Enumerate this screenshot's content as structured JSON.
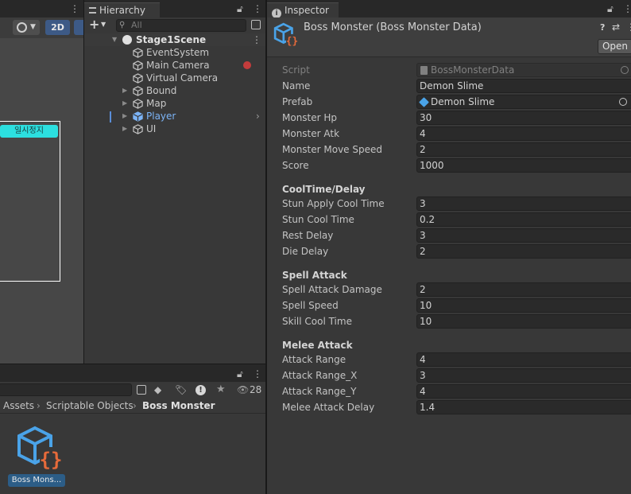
{
  "scene_view": {
    "toolbar_2d": "2D",
    "pause_button_label": "일시정지"
  },
  "hierarchy": {
    "tab_label": "Hierarchy",
    "search_placeholder": "All",
    "scene_name": "Stage1Scene",
    "items": [
      {
        "label": "EventSystem",
        "has_children": false
      },
      {
        "label": "Main Camera",
        "has_children": false
      },
      {
        "label": "Virtual Camera",
        "has_children": false
      },
      {
        "label": "Bound",
        "has_children": true
      },
      {
        "label": "Map",
        "has_children": true
      },
      {
        "label": "Player",
        "has_children": true,
        "highlighted": true
      },
      {
        "label": "UI",
        "has_children": true
      }
    ]
  },
  "project": {
    "breadcrumb": [
      "Assets",
      "Scriptable Objects",
      "Boss Monster"
    ],
    "hidden_count": "28",
    "asset_label": "Boss Mons..."
  },
  "inspector": {
    "tab_label": "Inspector",
    "title": "Boss Monster (Boss Monster Data)",
    "open_button": "Open",
    "script_label": "Script",
    "script_value": "BossMonsterData",
    "fields_top": [
      {
        "label": "Name",
        "value": "Demon Slime"
      },
      {
        "label": "Prefab",
        "value": "Demon Slime"
      },
      {
        "label": "Monster Hp",
        "value": "30"
      },
      {
        "label": "Monster Atk",
        "value": "4"
      },
      {
        "label": "Monster Move Speed",
        "value": "2"
      },
      {
        "label": "Score",
        "value": "1000"
      }
    ],
    "sections": [
      {
        "title": "CoolTime/Delay",
        "fields": [
          {
            "label": "Stun Apply Cool Time",
            "value": "3"
          },
          {
            "label": "Stun Cool Time",
            "value": "0.2"
          },
          {
            "label": "Rest Delay",
            "value": "3"
          },
          {
            "label": "Die Delay",
            "value": "2"
          }
        ]
      },
      {
        "title": "Spell Attack",
        "fields": [
          {
            "label": "Spell Attack Damage",
            "value": "2"
          },
          {
            "label": "Spell Speed",
            "value": "10"
          },
          {
            "label": "Skill Cool Time",
            "value": "10"
          }
        ]
      },
      {
        "title": "Melee Attack",
        "fields": [
          {
            "label": "Attack Range",
            "value": "4"
          },
          {
            "label": "Attack Range_X",
            "value": "3"
          },
          {
            "label": "Attack Range_Y",
            "value": "4"
          },
          {
            "label": "Melee Attack Delay",
            "value": "1.4"
          }
        ]
      }
    ]
  },
  "colors": {
    "accent_blue": "#7cb4f7",
    "asset_icon_blue": "#4aa3e8",
    "asset_icon_orange": "#e66a3a",
    "pause_button": "#2ce0e0"
  }
}
